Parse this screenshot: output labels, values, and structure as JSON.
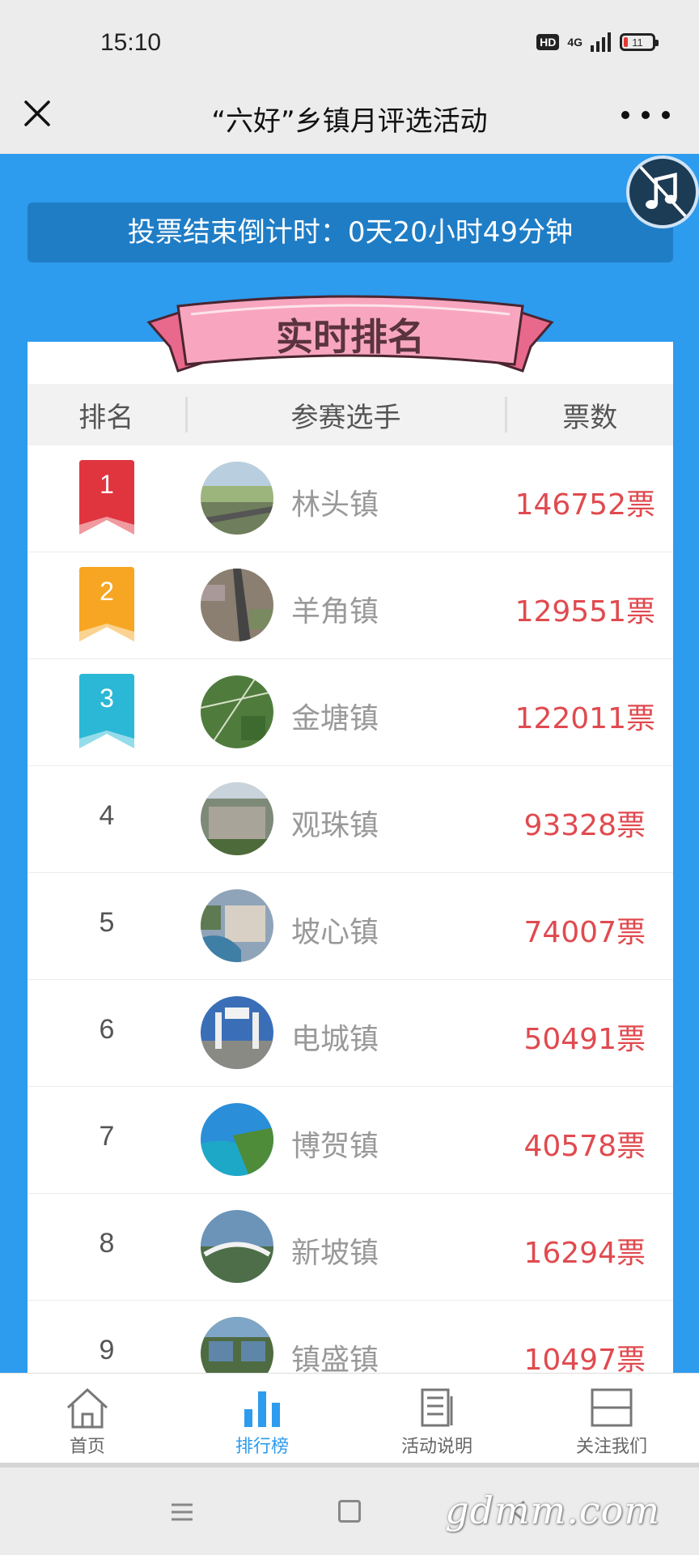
{
  "status_bar": {
    "time": "15:10",
    "hd": "HD",
    "network": "4G",
    "battery": "11"
  },
  "title_bar": {
    "title": "“六好”乡镇月评选活动",
    "close_icon": "close-icon",
    "more_icon": "more-icon"
  },
  "countdown": {
    "text": "投票结束倒计时：0天20小时49分钟"
  },
  "banner": {
    "title": "实时排名"
  },
  "table": {
    "headers": {
      "rank": "排名",
      "player": "参赛选手",
      "votes": "票数"
    },
    "rows": [
      {
        "rank": "1",
        "name": "林头镇",
        "votes": "146752票"
      },
      {
        "rank": "2",
        "name": "羊角镇",
        "votes": "129551票"
      },
      {
        "rank": "3",
        "name": "金塘镇",
        "votes": "122011票"
      },
      {
        "rank": "4",
        "name": "观珠镇",
        "votes": "93328票"
      },
      {
        "rank": "5",
        "name": "坡心镇",
        "votes": "74007票"
      },
      {
        "rank": "6",
        "name": "电城镇",
        "votes": "50491票"
      },
      {
        "rank": "7",
        "name": "博贺镇",
        "votes": "40578票"
      },
      {
        "rank": "8",
        "name": "新坡镇",
        "votes": "16294票"
      },
      {
        "rank": "9",
        "name": "镇盛镇",
        "votes": "10497票"
      }
    ]
  },
  "tabs": [
    {
      "label": "首页",
      "icon": "home-icon"
    },
    {
      "label": "排行榜",
      "icon": "bar-chart-icon",
      "active": true
    },
    {
      "label": "活动说明",
      "icon": "document-icon"
    },
    {
      "label": "关注我们",
      "icon": "qr-frame-icon"
    }
  ],
  "watermark": "gdmm.com",
  "colors": {
    "primary_blue": "#2d9bee",
    "vote_red": "#e04a4f",
    "gold": "#f6a623",
    "teal": "#2bb8d6",
    "ribbon_red": "#e0353f"
  }
}
